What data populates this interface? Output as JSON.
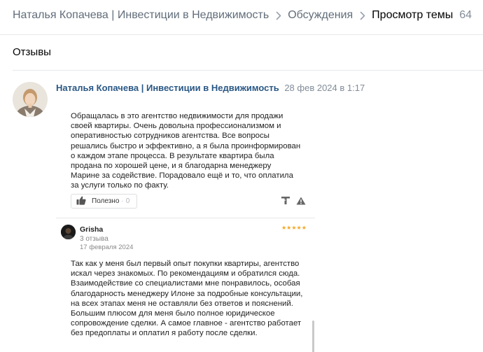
{
  "breadcrumb": {
    "group": "Наталья Копачева | Инвестиции в Недвижимость",
    "section": "Обсуждения",
    "current": "Просмотр темы",
    "count": "64"
  },
  "topic": {
    "title": "Отзывы"
  },
  "post": {
    "author": "Наталья Копачева | Инвестиции в Недвижимость",
    "date": "28 фев 2024 в 1:17",
    "attachment": {
      "review_text_1": "Обращалась в это агентство недвижимости для продажи своей квартиры. Очень довольна профессионализмом и оперативностью сотрудников агентства. Все вопросы решались быстро и эффективно, а я была проинформирован о каждом этапе процесса. В результате квартира была продана по хорошей цене, и я благодарна менеджеру Марине за содействие. Порадовало ещё и то, что оплатила за услуги только по факту.",
      "like_label": "Полезно",
      "like_separator": "·",
      "like_count": "0",
      "reviewer_name": "Grisha",
      "reviewer_reviews": "3 отзыва",
      "reviewer_date": "17 февраля 2024",
      "stars": "★★★★★",
      "review_text_2": "Так как у меня был первый опыт покупки квартиры, агентство искал через знакомых. По рекомендациям и обратился сюда. Взаимодействие со специалистами мне понравилось, особая благодарность менеджеру Илоне за подробные консультации, на всех этапах меня не оставляли без ответов и пояснений. Большим плюсом для меня было полное юридическое сопровождение сделки. А самое главное - агентство работает без предоплаты и оплатил я работу после сделки."
    }
  },
  "colors": {
    "link": "#2a5885",
    "muted": "#818c99",
    "stars": "#f5a623"
  },
  "icons": [
    "chevron-right-icon",
    "thumbs-up-icon",
    "translate-icon",
    "warning-icon"
  ]
}
